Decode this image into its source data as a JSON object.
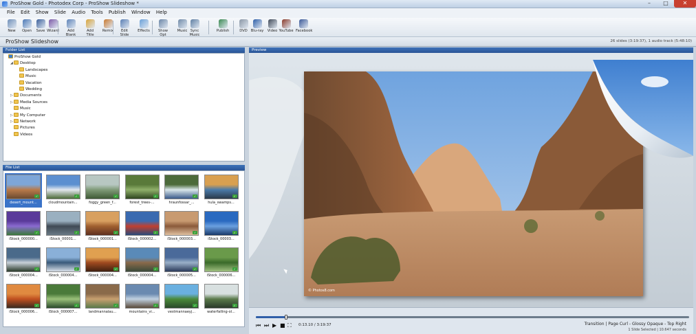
{
  "window": {
    "title": "ProShow Gold - Photodex Corp - ProShow Slideshow *",
    "min": "–",
    "max": "□",
    "close": "✕"
  },
  "menu": [
    "File",
    "Edit",
    "Show",
    "Slide",
    "Audio",
    "Tools",
    "Publish",
    "Window",
    "Help"
  ],
  "toolbar": [
    {
      "label": "New",
      "color": "#6f8fb8"
    },
    {
      "label": "Open",
      "color": "#4b78b5"
    },
    {
      "label": "Save",
      "color": "#3a5f9a"
    },
    {
      "label": "Wizard",
      "color": "#7c5aa6"
    },
    {
      "label": "Add Blank",
      "color": "#5e84b8"
    },
    {
      "label": "Add Title",
      "color": "#d9a53b"
    },
    {
      "label": "Remix",
      "color": "#c97a30"
    },
    {
      "label": "Edit Slide",
      "color": "#5a7fb4"
    },
    {
      "label": "Effects",
      "color": "#6aa0d8"
    },
    {
      "label": "Show Opt",
      "color": "#6b86a6"
    },
    {
      "label": "Music",
      "color": "#708aa8"
    },
    {
      "label": "Sync Music",
      "color": "#5f7fa3"
    },
    {
      "label": "Publish",
      "color": "#3b8a52"
    },
    {
      "label": "DVD",
      "color": "#8a96a5"
    },
    {
      "label": "Blu-ray",
      "color": "#2e5fa8"
    },
    {
      "label": "Video",
      "color": "#404a58"
    },
    {
      "label": "YouTube",
      "color": "#8a3a2a"
    },
    {
      "label": "Facebook",
      "color": "#3b5998"
    }
  ],
  "project": {
    "name": "ProShow Slideshow",
    "info": "26 slides (3:19:37), 1 audio track (5:48:10)"
  },
  "folder_panel": {
    "title": "Folder List",
    "items": [
      {
        "label": "ProShow Gold",
        "level": 0,
        "toggle": ""
      },
      {
        "label": "Desktop",
        "level": 1,
        "toggle": "◢"
      },
      {
        "label": "Landscapes",
        "level": 2,
        "toggle": ""
      },
      {
        "label": "Music",
        "level": 2,
        "toggle": ""
      },
      {
        "label": "Vacation",
        "level": 2,
        "toggle": ""
      },
      {
        "label": "Wedding",
        "level": 2,
        "toggle": ""
      },
      {
        "label": "Documents",
        "level": 1,
        "toggle": "▷"
      },
      {
        "label": "Media Sources",
        "level": 1,
        "toggle": "▷"
      },
      {
        "label": "Music",
        "level": 1,
        "toggle": ""
      },
      {
        "label": "My Computer",
        "level": 1,
        "toggle": "▷"
      },
      {
        "label": "Network",
        "level": 1,
        "toggle": "▷"
      },
      {
        "label": "Pictures",
        "level": 1,
        "toggle": ""
      },
      {
        "label": "Videos",
        "level": 1,
        "toggle": ""
      }
    ]
  },
  "file_panel": {
    "title": "File List",
    "files": [
      {
        "label": "desert_mount...",
        "colors": [
          "#7ea6d8",
          "#b97a4a",
          "#6b4a30"
        ],
        "selected": true
      },
      {
        "label": "cloudmountain...",
        "colors": [
          "#5c8fd0",
          "#e3e8ef",
          "#4d6b3a"
        ],
        "selected": false
      },
      {
        "label": "foggy_green_f...",
        "colors": [
          "#b8c7c2",
          "#7f9a78",
          "#3f5a35"
        ],
        "selected": false
      },
      {
        "label": "forest_trees-...",
        "colors": [
          "#5a7a3a",
          "#8fb06a",
          "#2e4520"
        ],
        "selected": false
      },
      {
        "label": "hraunfossar_...",
        "colors": [
          "#4c6a3a",
          "#d9e6ea",
          "#3a5a8a"
        ],
        "selected": false
      },
      {
        "label": "hula_swamps...",
        "colors": [
          "#d9a050",
          "#4a7aa8",
          "#2a3a4a"
        ],
        "selected": false
      },
      {
        "label": "iStock_000000...",
        "colors": [
          "#5a3a9a",
          "#8a6ad0",
          "#3a7a3a"
        ],
        "selected": false
      },
      {
        "label": "iStock_00001...",
        "colors": [
          "#9ab0c0",
          "#404a55",
          "#6a7a85"
        ],
        "selected": false
      },
      {
        "label": "iStock_000001...",
        "colors": [
          "#d8a060",
          "#a06030",
          "#603020"
        ],
        "selected": false
      },
      {
        "label": "iStock_000002...",
        "colors": [
          "#3a6ab0",
          "#c04030",
          "#2a4a7a"
        ],
        "selected": false
      },
      {
        "label": "iStock_000003...",
        "colors": [
          "#c89a70",
          "#8a5a3a",
          "#e0c0a0"
        ],
        "selected": false
      },
      {
        "label": "iStock_00003...",
        "colors": [
          "#2a6ac0",
          "#6aa0e0",
          "#1a3a6a"
        ],
        "selected": false
      },
      {
        "label": "iStock_000004...",
        "colors": [
          "#4a6a8a",
          "#c8d0d8",
          "#2a3a2a"
        ],
        "selected": false
      },
      {
        "label": "iStock_000004...",
        "colors": [
          "#8ab0d8",
          "#3a5a7a",
          "#d8e0e8"
        ],
        "selected": false
      },
      {
        "label": "iStock_000004...",
        "colors": [
          "#e0a050",
          "#a04a20",
          "#402010"
        ],
        "selected": false
      },
      {
        "label": "iStock_000004...",
        "colors": [
          "#5a8ab8",
          "#8a6a4a",
          "#3a4a3a"
        ],
        "selected": false
      },
      {
        "label": "iStock_000005...",
        "colors": [
          "#4a6a9a",
          "#9ab0c8",
          "#2a3a5a"
        ],
        "selected": false
      },
      {
        "label": "iStock_000006...",
        "colors": [
          "#6a9a4a",
          "#3a6a2a",
          "#a0c080"
        ],
        "selected": false
      },
      {
        "label": "iStock_000006...",
        "colors": [
          "#e08a40",
          "#c05020",
          "#3a2a20"
        ],
        "selected": false
      },
      {
        "label": "iStock_000007...",
        "colors": [
          "#4a7a3a",
          "#9ac07a",
          "#2a4a2a"
        ],
        "selected": false
      },
      {
        "label": "landmannalau...",
        "colors": [
          "#8a6a4a",
          "#c8a070",
          "#5a7a4a"
        ],
        "selected": false
      },
      {
        "label": "mountains_vi...",
        "colors": [
          "#6a8ab0",
          "#c0d0e0",
          "#5a4a3a"
        ],
        "selected": false
      },
      {
        "label": "vestmannaeyj...",
        "colors": [
          "#6ab0e0",
          "#4a8a3a",
          "#2a4a2a"
        ],
        "selected": false
      },
      {
        "label": "waterfalling-ol...",
        "colors": [
          "#d8e0e0",
          "#5a7a4a",
          "#2a3a2a"
        ],
        "selected": false
      }
    ]
  },
  "preview": {
    "title": "Preview",
    "watermark": "© Photos8.com"
  },
  "transport": {
    "time": "0:13.10 / 3:19:37",
    "progress": 0.07,
    "transition_info": "Transition  |  Page Curl - Glossy Opaque - Top Right",
    "selection_info": "1 Slide Selected  |  10.647 seconds",
    "buttons": [
      "⏮",
      "⏭",
      "▶",
      "■",
      "⛶"
    ]
  }
}
